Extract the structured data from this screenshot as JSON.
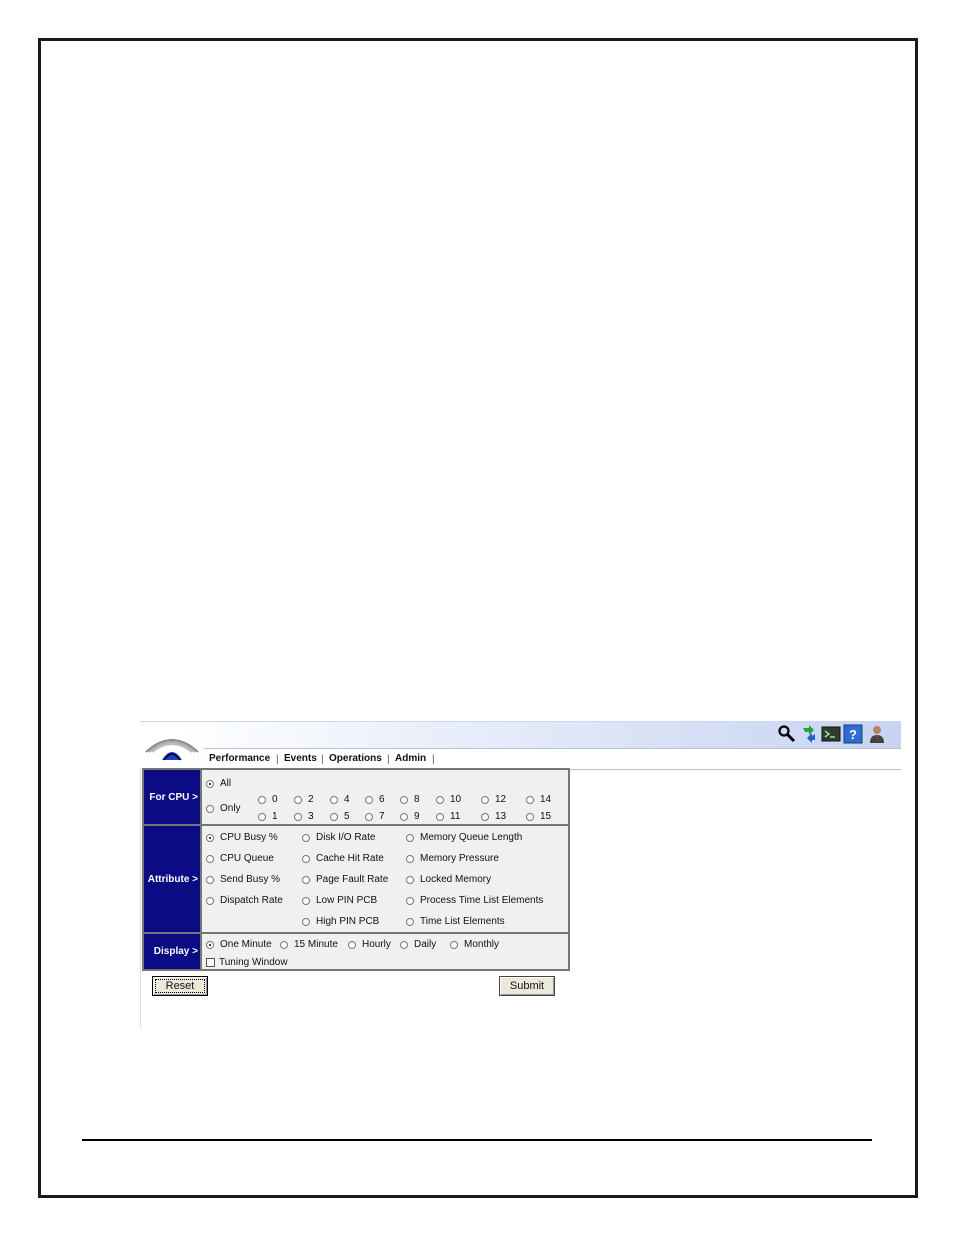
{
  "menu": {
    "items": [
      "Performance",
      "Events",
      "Operations",
      "Admin"
    ]
  },
  "toolbar_icons": [
    "search-icon",
    "refresh-icon",
    "terminal-icon",
    "help-icon",
    "user-icon"
  ],
  "form": {
    "cpu": {
      "label": "For CPU >",
      "all_label": "All",
      "only_label": "Only",
      "selected": "All",
      "numbers_top": [
        "0",
        "2",
        "4",
        "6",
        "8",
        "10",
        "12",
        "14"
      ],
      "numbers_bottom": [
        "1",
        "3",
        "5",
        "7",
        "9",
        "11",
        "13",
        "15"
      ]
    },
    "attribute": {
      "label": "Attribute >",
      "selected": "CPU Busy %",
      "col1": [
        "CPU Busy %",
        "CPU Queue",
        "Send Busy %",
        "Dispatch Rate"
      ],
      "col2": [
        "Disk I/O Rate",
        "Cache Hit Rate",
        "Page Fault Rate",
        "Low PIN PCB",
        "High PIN PCB"
      ],
      "col3": [
        "Memory Queue Length",
        "Memory Pressure",
        "Locked Memory",
        "Process Time List Elements",
        "Time List Elements"
      ]
    },
    "display": {
      "label": "Display >",
      "selected": "One Minute",
      "options": [
        "One Minute",
        "15 Minute",
        "Hourly",
        "Daily",
        "Monthly"
      ],
      "tuning_label": "Tuning Window",
      "tuning_checked": false
    }
  },
  "buttons": {
    "reset": "Reset",
    "submit": "Submit"
  },
  "colors": {
    "row_label_bg": "#0b0b84",
    "header_gradient_end": "#c6d3f1"
  }
}
